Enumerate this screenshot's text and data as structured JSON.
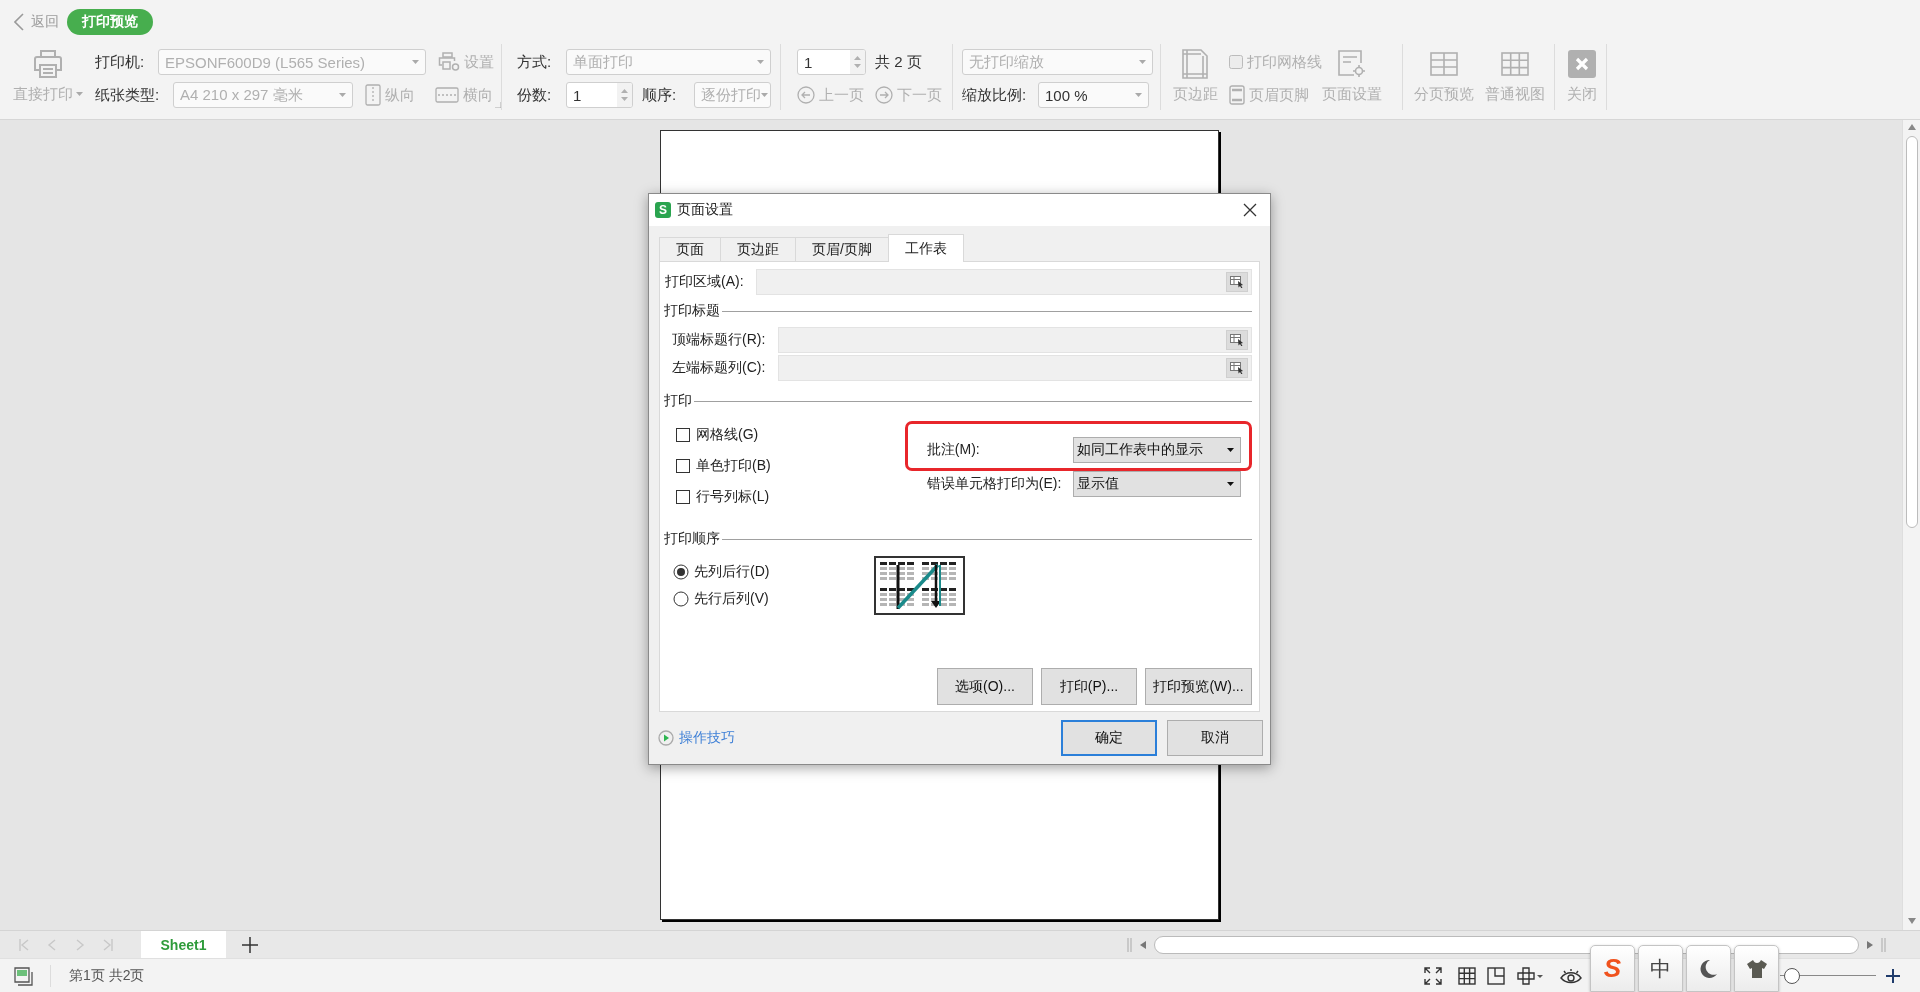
{
  "header": {
    "back": "返回",
    "mode_badge": "打印预览"
  },
  "toolbar": {
    "direct_print": {
      "label": "直接打印",
      "disabled": true
    },
    "printer": {
      "label": "打印机:",
      "value": "EPSONF600D9 (L565 Series)",
      "disabled": true
    },
    "printer_settings": {
      "label": "设置",
      "disabled": true
    },
    "paper": {
      "label": "纸张类型:",
      "value": "A4 210 x 297 毫米",
      "disabled": true
    },
    "portrait": {
      "label": "纵向",
      "disabled": true
    },
    "landscape": {
      "label": "横向",
      "disabled": true
    },
    "mode": {
      "label": "方式:",
      "value": "单面打印",
      "disabled": true
    },
    "copies": {
      "label": "份数:",
      "value": "1",
      "disabled": false
    },
    "order": {
      "label": "顺序:",
      "value": "逐份打印",
      "disabled": true
    },
    "page_number": {
      "value": "1",
      "disabled": false
    },
    "page_total": "共 2 页",
    "prev_page": {
      "label": "上一页",
      "disabled": true
    },
    "next_page": {
      "label": "下一页",
      "disabled": true
    },
    "scaling": {
      "value": "无打印缩放",
      "disabled": true
    },
    "zoom": {
      "label": "缩放比例:",
      "value": "100 %",
      "disabled": false
    },
    "margins": {
      "label": "页边距",
      "disabled": true
    },
    "print_gridlines": {
      "label": "打印网格线",
      "checked": false,
      "disabled": true
    },
    "header_footer": {
      "label": "页眉页脚",
      "disabled": true
    },
    "page_setup": {
      "label": "页面设置",
      "disabled": true
    },
    "page_break_preview": {
      "label": "分页预览",
      "disabled": true
    },
    "normal_view": {
      "label": "普通视图",
      "disabled": true
    },
    "close": {
      "label": "关闭",
      "disabled": true
    }
  },
  "dialog": {
    "icon_letter": "S",
    "title": "页面设置",
    "tabs": [
      {
        "label": "页面",
        "selected": false
      },
      {
        "label": "页边距",
        "selected": false
      },
      {
        "label": "页眉/页脚",
        "selected": false
      },
      {
        "label": "工作表",
        "selected": true
      }
    ],
    "print_area": {
      "label": "打印区域(A):"
    },
    "print_titles": {
      "heading": "打印标题",
      "fields": [
        {
          "label": "顶端标题行(R):"
        },
        {
          "label": "左端标题列(C):"
        }
      ]
    },
    "print": {
      "heading": "打印",
      "options": [
        {
          "label": "网格线(G)",
          "checked": false
        },
        {
          "label": "单色打印(B)",
          "checked": false
        },
        {
          "label": "行号列标(L)",
          "checked": false
        }
      ],
      "comments": {
        "label": "批注(M):",
        "value": "如同工作表中的显示",
        "highlighted": true
      },
      "errors": {
        "label": "错误单元格打印为(E):",
        "value": "显示值"
      }
    },
    "page_order": {
      "heading": "打印顺序",
      "options": [
        {
          "label": "先列后行(D)",
          "selected": true
        },
        {
          "label": "先行后列(V)",
          "selected": false
        }
      ]
    },
    "action_buttons": [
      "选项(O)...",
      "打印(P)...",
      "打印预览(W)..."
    ],
    "tips_link": "操作技巧",
    "buttons": [
      {
        "label": "确定",
        "default": true
      },
      {
        "label": "取消",
        "default": false
      }
    ]
  },
  "sheet_tabs": [
    {
      "label": "Sheet1",
      "selected": true
    }
  ],
  "status_bar": {
    "page_info": "第1页 共2页",
    "zoom_slider": {
      "level": 0.05
    }
  },
  "ime_bar": {
    "logo": "S",
    "mode": "中"
  }
}
